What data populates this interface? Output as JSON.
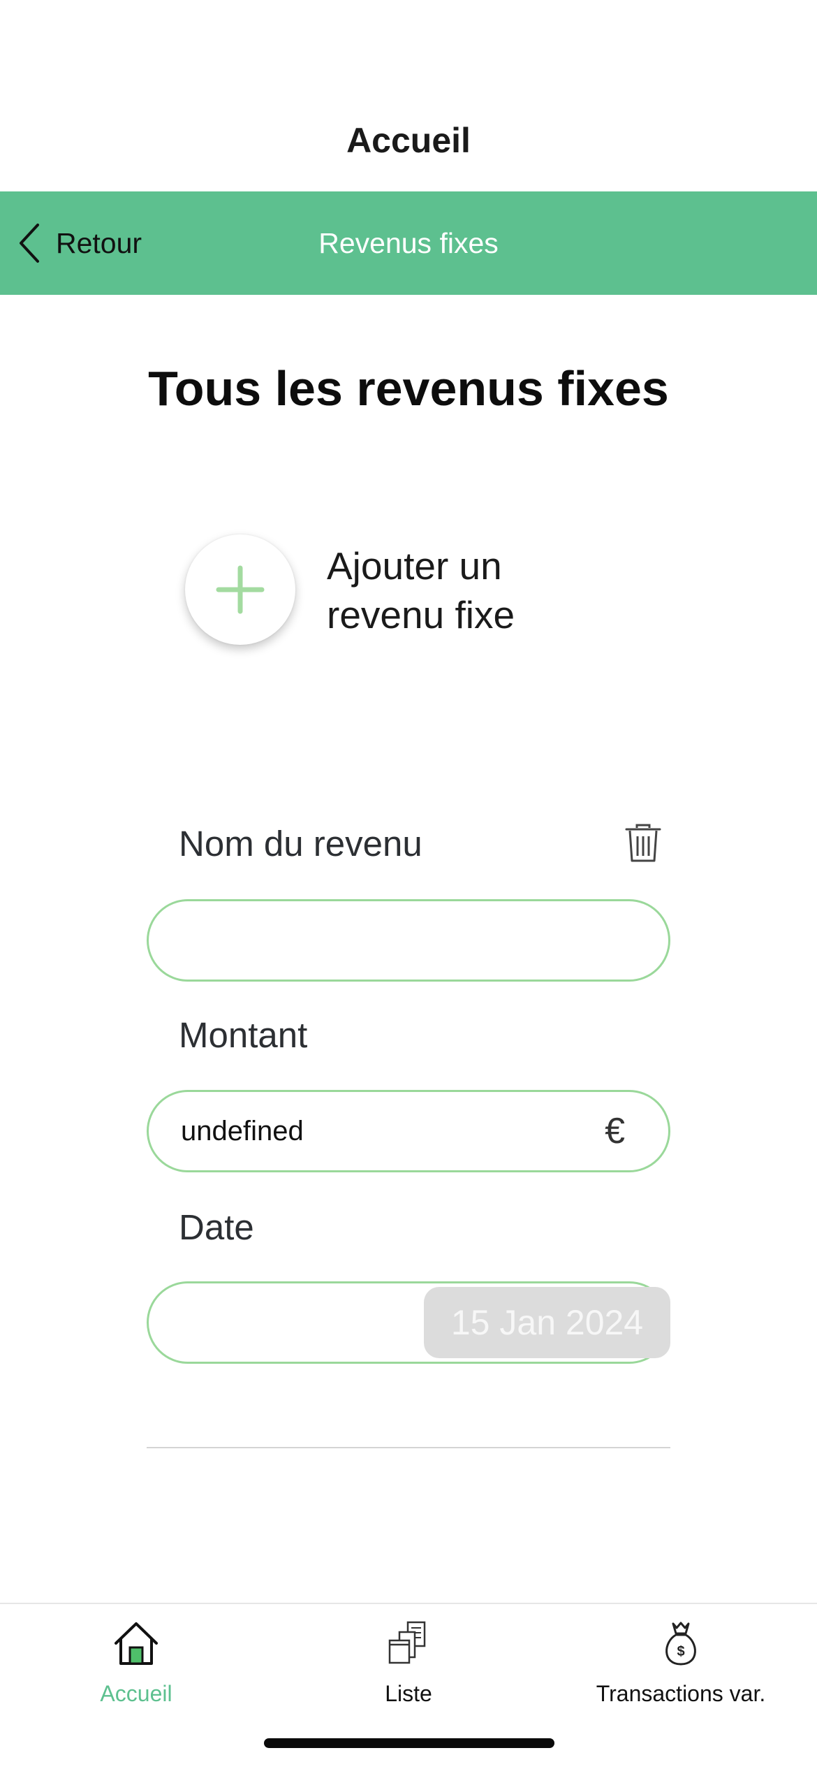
{
  "nav": {
    "title": "Accueil"
  },
  "header": {
    "back_label": "Retour",
    "title": "Revenus fixes",
    "color": "#5dc08f"
  },
  "page": {
    "heading": "Tous les revenus fixes"
  },
  "add": {
    "label": "Ajouter un revenu fixe",
    "icon": "plus-icon"
  },
  "form": {
    "name_label": "Nom du revenu",
    "name_value": "",
    "amount_label": "Montant",
    "amount_value": "undefined",
    "currency": "€",
    "date_label": "Date",
    "date_value": "15 Jan 2024",
    "delete_icon": "trash-icon",
    "border_color": "#9ad89a"
  },
  "tabs": [
    {
      "label": "Accueil",
      "icon": "home-icon",
      "active": true
    },
    {
      "label": "Liste",
      "icon": "documents-icon",
      "active": false
    },
    {
      "label": "Transactions var.",
      "icon": "money-bag-icon",
      "active": false
    }
  ]
}
